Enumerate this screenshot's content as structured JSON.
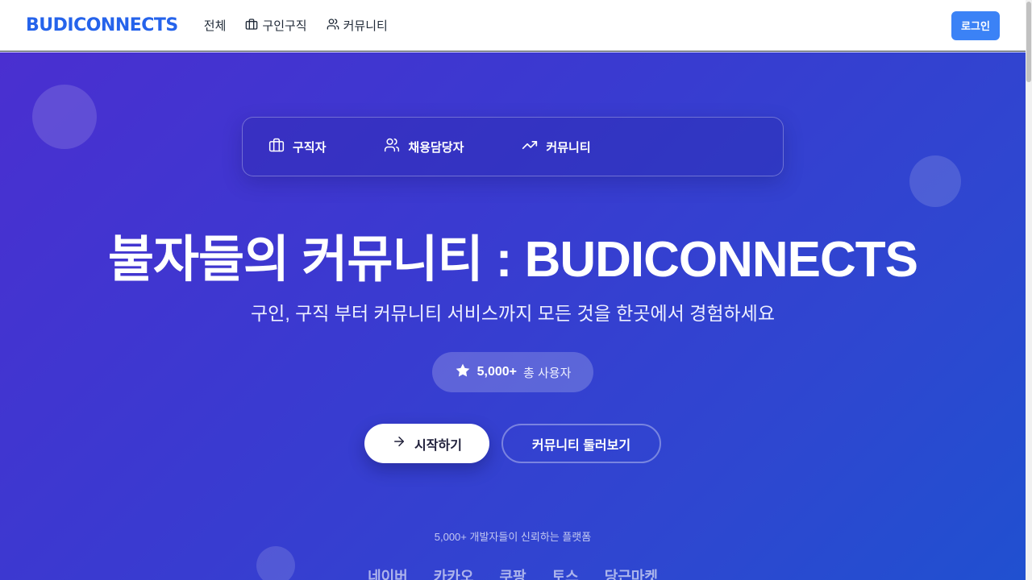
{
  "header": {
    "logo": "BUDICONNECTS",
    "nav": [
      {
        "label": "전체",
        "icon": "none"
      },
      {
        "label": "구인구직",
        "icon": "briefcase-icon"
      },
      {
        "label": "커뮤니티",
        "icon": "users-icon"
      }
    ],
    "login_label": "로그인"
  },
  "hero": {
    "tabs": [
      {
        "label": "구직자",
        "icon": "briefcase-icon"
      },
      {
        "label": "채용담당자",
        "icon": "users-icon"
      },
      {
        "label": "커뮤니티",
        "icon": "trending-up-icon"
      }
    ],
    "title": "불자들의 커뮤니티 : BUDICONNECTS",
    "subtitle": "구인, 구직 부터 커뮤니티 서비스까지 모든 것을 한곳에서 경험하세요",
    "stat": {
      "value": "5,000+",
      "label": "총 사용자",
      "icon": "star-icon"
    },
    "start_button": "시작하기",
    "community_button": "커뮤니티 둘러보기",
    "trust_text": "5,000+ 개발자들이 신뢰하는 플랫폼",
    "partners": [
      "네이버",
      "카카오",
      "쿠팡",
      "토스",
      "당근마켓"
    ]
  },
  "colors": {
    "brand": "#2563eb",
    "login_button": "#3b82f6",
    "hero_gradient_start": "#4a2fd0",
    "hero_gradient_end": "#2050d0"
  }
}
